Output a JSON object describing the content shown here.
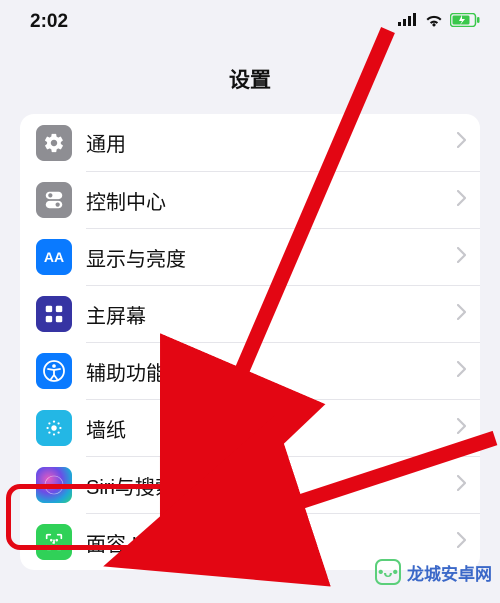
{
  "status": {
    "time": "2:02"
  },
  "header": {
    "title": "设置"
  },
  "rows": [
    {
      "label": "通用",
      "icon_name": "general-icon"
    },
    {
      "label": "控制中心",
      "icon_name": "control-center-icon"
    },
    {
      "label": "显示与亮度",
      "icon_name": "display-brightness-icon"
    },
    {
      "label": "主屏幕",
      "icon_name": "home-screen-icon"
    },
    {
      "label": "辅助功能",
      "icon_name": "accessibility-icon"
    },
    {
      "label": "墙纸",
      "icon_name": "wallpaper-icon"
    },
    {
      "label": "Siri与搜索",
      "icon_name": "siri-icon"
    },
    {
      "label": "面容 ID与密码",
      "icon_name": "faceid-icon"
    }
  ],
  "annotation": {
    "highlighted_row_label": "Siri与搜索",
    "arrow_color": "#e30613"
  },
  "watermark": {
    "text": "龙城安卓网"
  }
}
